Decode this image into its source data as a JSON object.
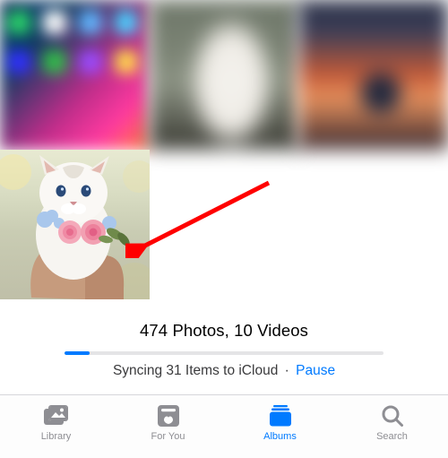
{
  "summary": {
    "count_text": "474 Photos, 10 Videos",
    "sync_text": "Syncing 31 Items to iCloud",
    "separator": "·",
    "pause_label": "Pause",
    "progress_percent": 8
  },
  "tabs": {
    "library": "Library",
    "for_you": "For You",
    "albums": "Albums",
    "search": "Search",
    "active": "albums"
  },
  "colors": {
    "accent": "#007aff",
    "inactive": "#8e8e93",
    "track": "#e4e4e6"
  }
}
